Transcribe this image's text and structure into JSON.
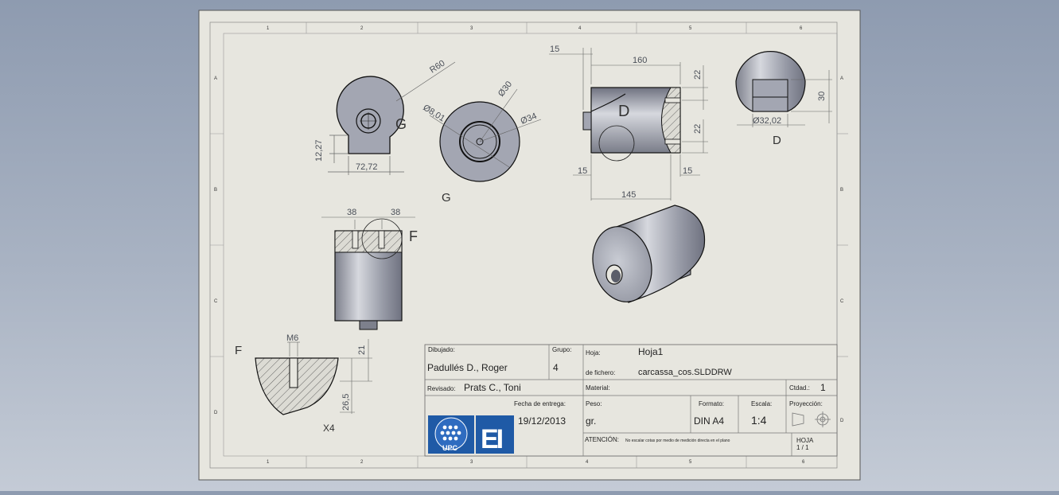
{
  "sheet": {
    "zones_top": [
      "1",
      "2",
      "3",
      "4",
      "5",
      "6"
    ],
    "zones_side": [
      "A",
      "B",
      "C",
      "D"
    ]
  },
  "dimensions": {
    "r60": "R60",
    "d801": "Ø8,01",
    "d30": "Ø30",
    "d34": "Ø34",
    "d1227": "12,27",
    "d7272": "72,72",
    "d15_top": "15",
    "d160": "160",
    "d22_a": "22",
    "d22_b": "22",
    "d15_left": "15",
    "d15_right": "15",
    "d145": "145",
    "d30_side": "30",
    "d3202": "Ø32,02",
    "d38_a": "38",
    "d38_b": "38",
    "m6": "M6",
    "d21": "21",
    "d265": "26,5"
  },
  "labels": {
    "g_marker": "G",
    "g_view": "G",
    "d_marker": "D",
    "d_view": "D",
    "f_marker": "F",
    "f_view": "F",
    "x4": "X4"
  },
  "title_block": {
    "dibujado_label": "Dibujado:",
    "dibujado_value": "Padullés D., Roger",
    "grupo_label": "Grupo:",
    "grupo_value": "4",
    "hoja_label": "Hoja:",
    "hoja_value": "Hoja1",
    "fichero_label": "de fichero:",
    "fichero_value": "carcassa_cos.SLDDRW",
    "revisado_label": "Revisado:",
    "revisado_value": "Prats C., Toni",
    "material_label": "Material:",
    "ctdad_label": "Ctdad.:",
    "ctdad_value": "1",
    "fecha_label": "Fecha de entrega:",
    "fecha_value": "19/12/2013",
    "peso_label": "Peso:",
    "peso_value": "gr.",
    "formato_label": "Formato:",
    "formato_value": "DIN A4",
    "escala_label": "Escala:",
    "escala_value": "1:4",
    "proyeccion_label": "Proyección:",
    "atencion_label": "ATENCIÓN:",
    "atencion_text": "No escalar cotas por medio de medición directa en el plano",
    "hoja_count_label": "HOJA",
    "hoja_count_value": "1 / 1",
    "logo_upc": "UPC",
    "logo_ei": "EI"
  },
  "colors": {
    "sheet": "#e7e6df",
    "part_fill": "#9ea1ad",
    "dimension": "#4a4f58",
    "logo_blue": "#1f5aa6"
  }
}
